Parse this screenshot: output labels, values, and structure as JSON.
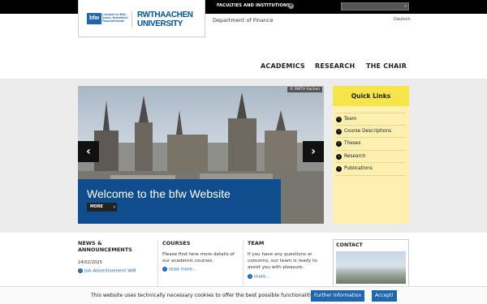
{
  "topbar": {
    "faculties_label": "FACULTIES AND INSTITUTIONS",
    "search_placeholder": ""
  },
  "logo": {
    "bfw_mark": "bfw",
    "bfw_text": "Lehrstuhl für BWL, insbes. Betriebliche Finanzwirtschaft",
    "rwth_line1": "RWTHAACHEN",
    "rwth_line2": "UNIVERSITY"
  },
  "header": {
    "department": "Department of Finance",
    "language": "Deutsch"
  },
  "nav": {
    "items": [
      "ACADEMICS",
      "RESEARCH",
      "THE CHAIR"
    ]
  },
  "hero": {
    "copyright": "© RWTH Aachen",
    "title": "Welcome to the bfw Website",
    "more_label": "MORE",
    "prev_icon": "chevron-left-icon",
    "next_icon": "chevron-right-icon"
  },
  "quick_links": {
    "title": "Quick Links",
    "items": [
      "Team",
      "Course Descriptions",
      "Theses",
      "Research",
      "Publications"
    ]
  },
  "news": {
    "title_line1": "NEWS &",
    "title_line2": "ANNOUNCEMENTS",
    "date": "24/02/2025",
    "item": "Job Advertisement WM"
  },
  "courses": {
    "title": "COURSES",
    "text_line1": "Please find here more details of",
    "text_line2": "our academic courses.",
    "link": "read more..."
  },
  "team": {
    "title": "TEAM",
    "text_line1": "If you have any questions or",
    "text_line2": "concerns, our team is ready to",
    "text_line3": "assist you with pleasure.",
    "link": "more..."
  },
  "contact": {
    "title": "CONTACT"
  },
  "cookie": {
    "text": "This website uses technically necessary cookies to offer the best possible functionality.",
    "info_button": "Further Information",
    "accept_button": "Accept!"
  },
  "colors": {
    "brand_blue": "#1f66ad",
    "rwth_blue": "#00549f",
    "quicklinks_yellow": "#f5e44a"
  }
}
